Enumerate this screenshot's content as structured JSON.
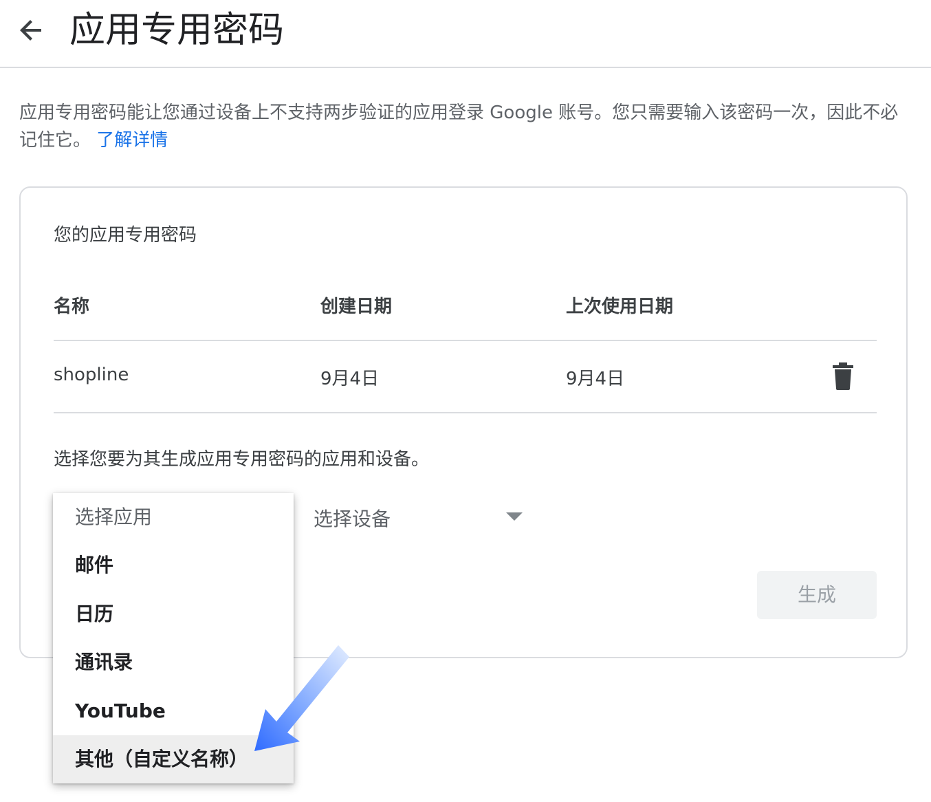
{
  "header": {
    "title": "应用专用密码"
  },
  "intro": {
    "text": "应用专用密码能让您通过设备上不支持两步验证的应用登录 Google 账号。您只需要输入该密码一次，因此不必记住它。",
    "learn_more": "了解详情"
  },
  "card": {
    "title": "您的应用专用密码",
    "columns": [
      "名称",
      "创建日期",
      "上次使用日期"
    ],
    "rows": [
      {
        "name": "shopline",
        "created": "9月4日",
        "last_used": "9月4日"
      }
    ],
    "prompt": "选择您要为其生成应用专用密码的应用和设备。",
    "app_select": {
      "placeholder": "选择应用",
      "options": [
        "邮件",
        "日历",
        "通讯录",
        "YouTube",
        "其他（自定义名称）"
      ],
      "highlighted": "其他（自定义名称）"
    },
    "device_select": {
      "placeholder": "选择设备"
    },
    "generate_label": "生成"
  },
  "colors": {
    "link": "#1a73e8",
    "divider": "#dadce0",
    "arrow_annotation": "#4285f4",
    "highlight_bg": "#eeeeee"
  },
  "icons": {
    "back": "arrow-back-icon",
    "delete": "trash-icon",
    "dropdown": "triangle-down-icon",
    "annotation": "pointer-arrow-icon"
  }
}
